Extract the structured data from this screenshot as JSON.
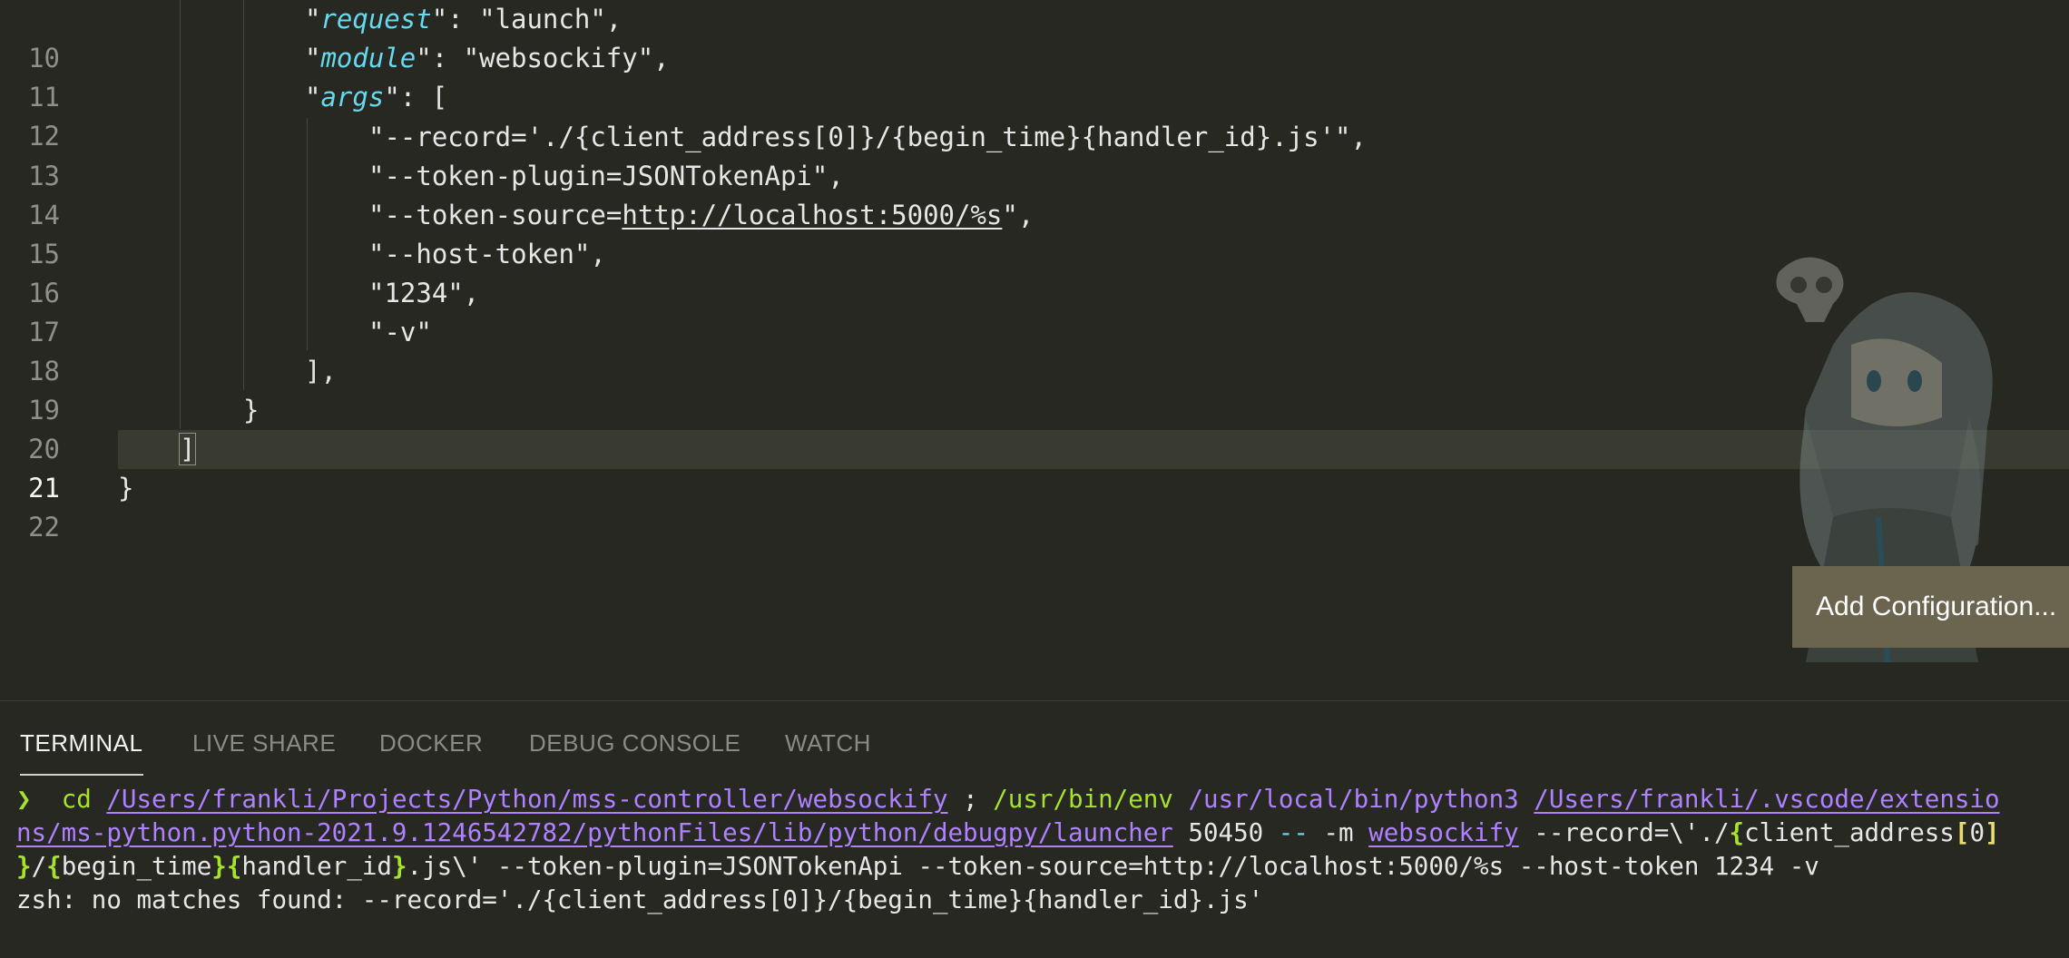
{
  "editor": {
    "lines": [
      {
        "number": "10",
        "key": "request",
        "value": "launch",
        "suffix": ","
      },
      {
        "number": "11",
        "key": "module",
        "value": "websockify",
        "suffix": ","
      },
      {
        "number": "12",
        "key": "args",
        "open": "["
      },
      {
        "number": "13",
        "text": "\"--record='./{client_address[0]}/{begin_time}{handler_id}.js'\","
      },
      {
        "number": "14",
        "text": "\"--token-plugin=JSONTokenApi\","
      },
      {
        "number": "15",
        "text_before": "\"--token-source=",
        "link": "http://localhost:5000/%s",
        "text_after": "\","
      },
      {
        "number": "16",
        "text": "\"--host-token\","
      },
      {
        "number": "17",
        "text": "\"1234\","
      },
      {
        "number": "18",
        "text": "\"-v\""
      },
      {
        "number": "19",
        "text": "],"
      },
      {
        "number": "20",
        "text": "}"
      },
      {
        "number": "21",
        "text": "]"
      },
      {
        "number": "22",
        "text": "}"
      }
    ]
  },
  "overlay": {
    "add_configuration_label": "Add Configuration..."
  },
  "panel": {
    "tabs": [
      {
        "label": "TERMINAL",
        "active": true
      },
      {
        "label": "LIVE SHARE",
        "active": false
      },
      {
        "label": "DOCKER",
        "active": false
      },
      {
        "label": "DEBUG CONSOLE",
        "active": false
      },
      {
        "label": "WATCH",
        "active": false
      }
    ]
  },
  "terminal": {
    "prompt": "❯",
    "cmd_cd": "cd",
    "cd_path": "/Users/frankli/Projects/Python/mss-controller/websockify",
    "semicolon": ";",
    "env": "/usr/bin/env",
    "python": "/usr/local/bin/python3",
    "launcher_part1": "/Users/frankli/.vscode/extensio",
    "launcher_part2": "ns/ms-python.python-2021.9.1246542782/pythonFiles/lib/python/debugpy/launcher",
    "port": "50450",
    "dashdash": "--",
    "m_flag": "-m",
    "module": "websockify",
    "record_arg_start": "--record=\\'./",
    "brace_open": "{",
    "client_address": "client_address",
    "bracket_open": "[",
    "zero": "0",
    "bracket_close": "]",
    "brace_close": "}",
    "slash": "/",
    "begin_time": "begin_time",
    "handler_id": "handler_id",
    "line3_tail": ".js\\' --token-plugin=JSONTokenApi --token-source=http://localhost:5000/%s --host-token 1234 -v",
    "error": "zsh: no matches found: --record='./{client_address[0]}/{begin_time}{handler_id}.js'"
  },
  "colors": {
    "editor_bg": "#272822",
    "key_cyan": "#66d9ef",
    "path_purple": "#ae81ff",
    "green": "#a6e22e",
    "yellow": "#e6db74",
    "button_bg": "#6b6550"
  }
}
